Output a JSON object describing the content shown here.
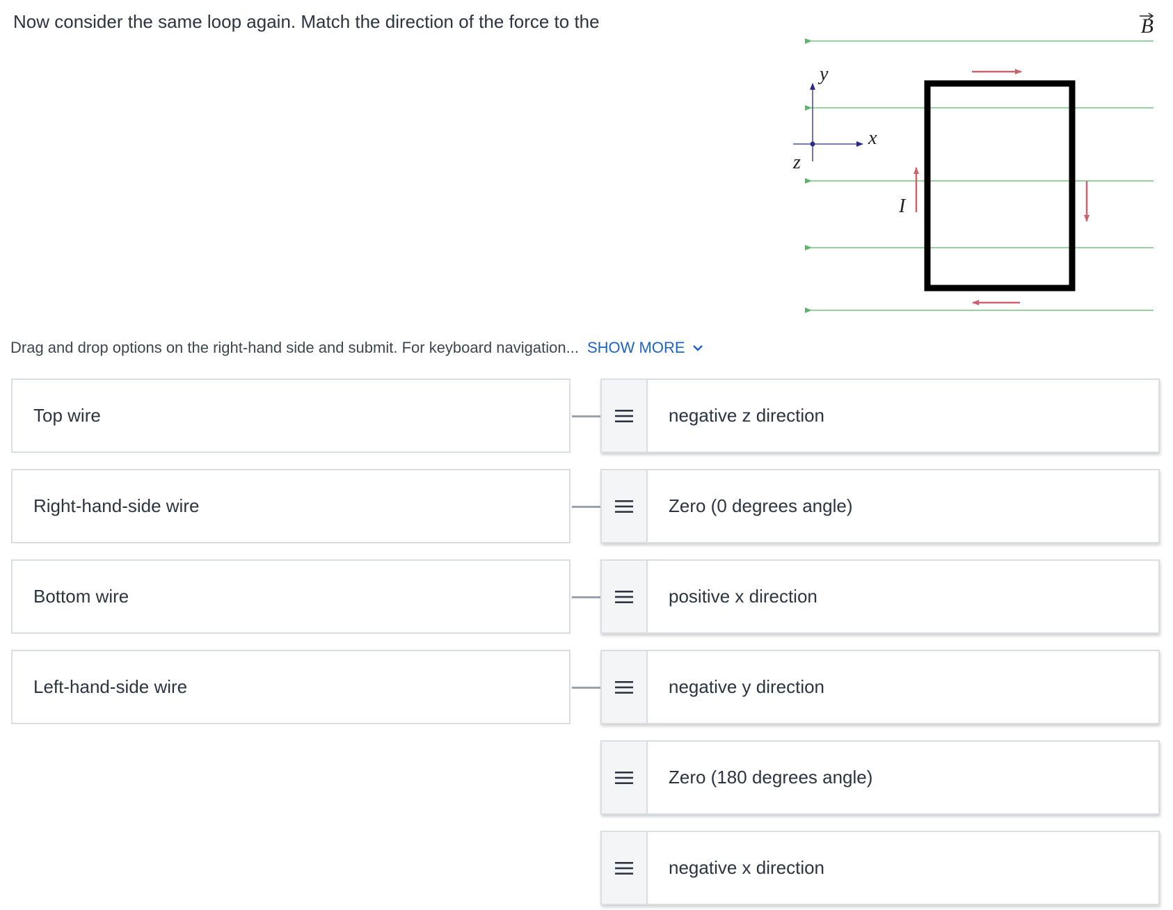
{
  "question": {
    "text": "Now consider the same loop again. Match the direction of the force to the"
  },
  "figure": {
    "field_label": "B",
    "axis_y": "y",
    "axis_x": "x",
    "axis_z": "z",
    "current_label": "I",
    "colors": {
      "field_lines": "#5ab56a",
      "current_arrows": "#c9636f",
      "axes": "#2a2a8c",
      "loop": "#000000"
    }
  },
  "instructions": {
    "text": "Drag and drop options on the right-hand side and submit. For keyboard navigation...",
    "show_more": "SHOW MORE",
    "show_more_icon": "chevron-down-icon"
  },
  "targets": [
    {
      "label": "Top wire"
    },
    {
      "label": "Right-hand-side wire"
    },
    {
      "label": "Bottom wire"
    },
    {
      "label": "Left-hand-side wire"
    }
  ],
  "options": [
    {
      "label": "negative z direction"
    },
    {
      "label": "Zero (0 degrees angle)"
    },
    {
      "label": "positive x direction"
    },
    {
      "label": "negative y direction"
    },
    {
      "label": "Zero (180 degrees angle)"
    },
    {
      "label": "negative x direction"
    }
  ],
  "icons": {
    "drag_handle": "drag-handle-icon"
  },
  "colors": {
    "text": "#2b3440",
    "link": "#1f63c4",
    "border": "#dadde1",
    "connector": "#9ba2ab",
    "handle_bg": "#f4f5f6"
  }
}
